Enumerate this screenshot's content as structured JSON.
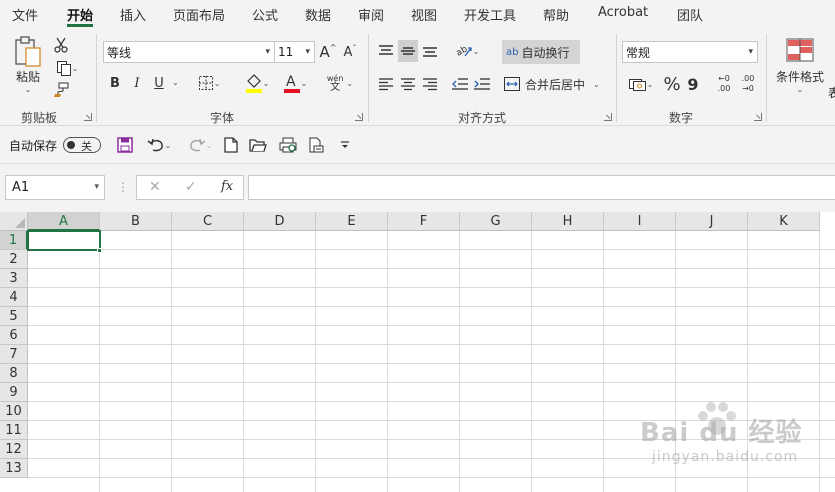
{
  "menu": {
    "items": [
      "文件",
      "开始",
      "插入",
      "页面布局",
      "公式",
      "数据",
      "审阅",
      "视图",
      "开发工具",
      "帮助",
      "Acrobat",
      "团队"
    ],
    "active_index": 1
  },
  "ribbon": {
    "clipboard": {
      "paste_label": "粘贴",
      "group_label": "剪贴板"
    },
    "font": {
      "font_name": "等线",
      "font_size": "11",
      "group_label": "字体",
      "bold": "B",
      "italic": "I",
      "underline": "U",
      "phonetic_top": "wén",
      "phonetic_bottom": "文",
      "grow": "A",
      "shrink": "A"
    },
    "alignment": {
      "wrap_text": "自动换行",
      "merge_center": "合并后居中",
      "group_label": "对齐方式",
      "wrap_icon": "ab"
    },
    "number": {
      "format": "常规",
      "group_label": "数字",
      "percent": "%",
      "comma": "9",
      "inc_dec_top": "←0",
      "inc_dec_bottom": ".00",
      "dec_dec_top": ".00",
      "dec_dec_bottom": "→0"
    },
    "styles": {
      "conditional_format": "条件格式",
      "partial": "表"
    }
  },
  "qat": {
    "autosave_label": "自动保存",
    "toggle_state": "关"
  },
  "formula_bar": {
    "name_box": "A1",
    "fx": "fx",
    "cancel": "✕",
    "enter": "✓",
    "separator": "⋮"
  },
  "grid": {
    "columns": [
      "A",
      "B",
      "C",
      "D",
      "E",
      "F",
      "G",
      "H",
      "I",
      "J",
      "K"
    ],
    "rows": [
      "1",
      "2",
      "3",
      "4",
      "5",
      "6",
      "7",
      "8",
      "9",
      "10",
      "11",
      "12",
      "13"
    ],
    "selected_column": "A",
    "selected_row": "1"
  },
  "watermark": {
    "brand": "Bai du 经验",
    "url": "jingyan.baidu.com"
  },
  "colors": {
    "accent": "#217346",
    "font_color_bar": "#e81123",
    "highlight_bar": "#ffff00"
  }
}
